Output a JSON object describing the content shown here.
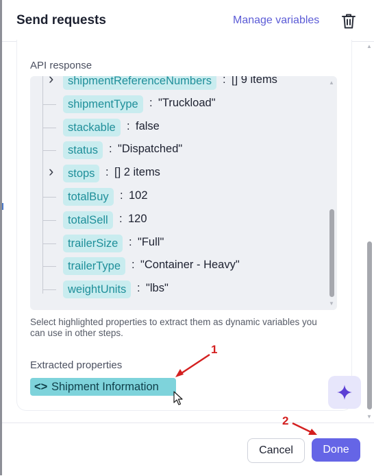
{
  "header": {
    "title": "Send requests",
    "manage_variables": "Manage variables",
    "trash_icon": "trash-icon"
  },
  "api_response": {
    "label": "API response",
    "rows": [
      {
        "key": "shipmentReferenceNumbers",
        "value": "[]  9 items",
        "expandable": true
      },
      {
        "key": "shipmentType",
        "value": "\"Truckload\"",
        "expandable": false
      },
      {
        "key": "stackable",
        "value": "false",
        "expandable": false
      },
      {
        "key": "status",
        "value": "\"Dispatched\"",
        "expandable": false
      },
      {
        "key": "stops",
        "value": "[]  2 items",
        "expandable": true
      },
      {
        "key": "totalBuy",
        "value": "102",
        "expandable": false
      },
      {
        "key": "totalSell",
        "value": "120",
        "expandable": false
      },
      {
        "key": "trailerSize",
        "value": "\"Full\"",
        "expandable": false
      },
      {
        "key": "trailerType",
        "value": "\"Container - Heavy\"",
        "expandable": false
      },
      {
        "key": "weightUnits",
        "value": "\"lbs\"",
        "expandable": false
      }
    ],
    "separator": ":"
  },
  "help_text": "Select highlighted properties to extract them as dynamic variables you can use in other steps.",
  "extracted": {
    "label": "Extracted properties",
    "chip_code": "<>",
    "chip_label": "Shipment Information"
  },
  "footer": {
    "cancel": "Cancel",
    "done": "Done"
  },
  "annotations": {
    "one": "1",
    "two": "2",
    "color": "#d42020"
  },
  "colors": {
    "accent": "#6565e6",
    "key_pill_bg": "#c9ecef",
    "key_pill_text": "#1f8f9a",
    "chip_bg": "#7ed3db"
  }
}
